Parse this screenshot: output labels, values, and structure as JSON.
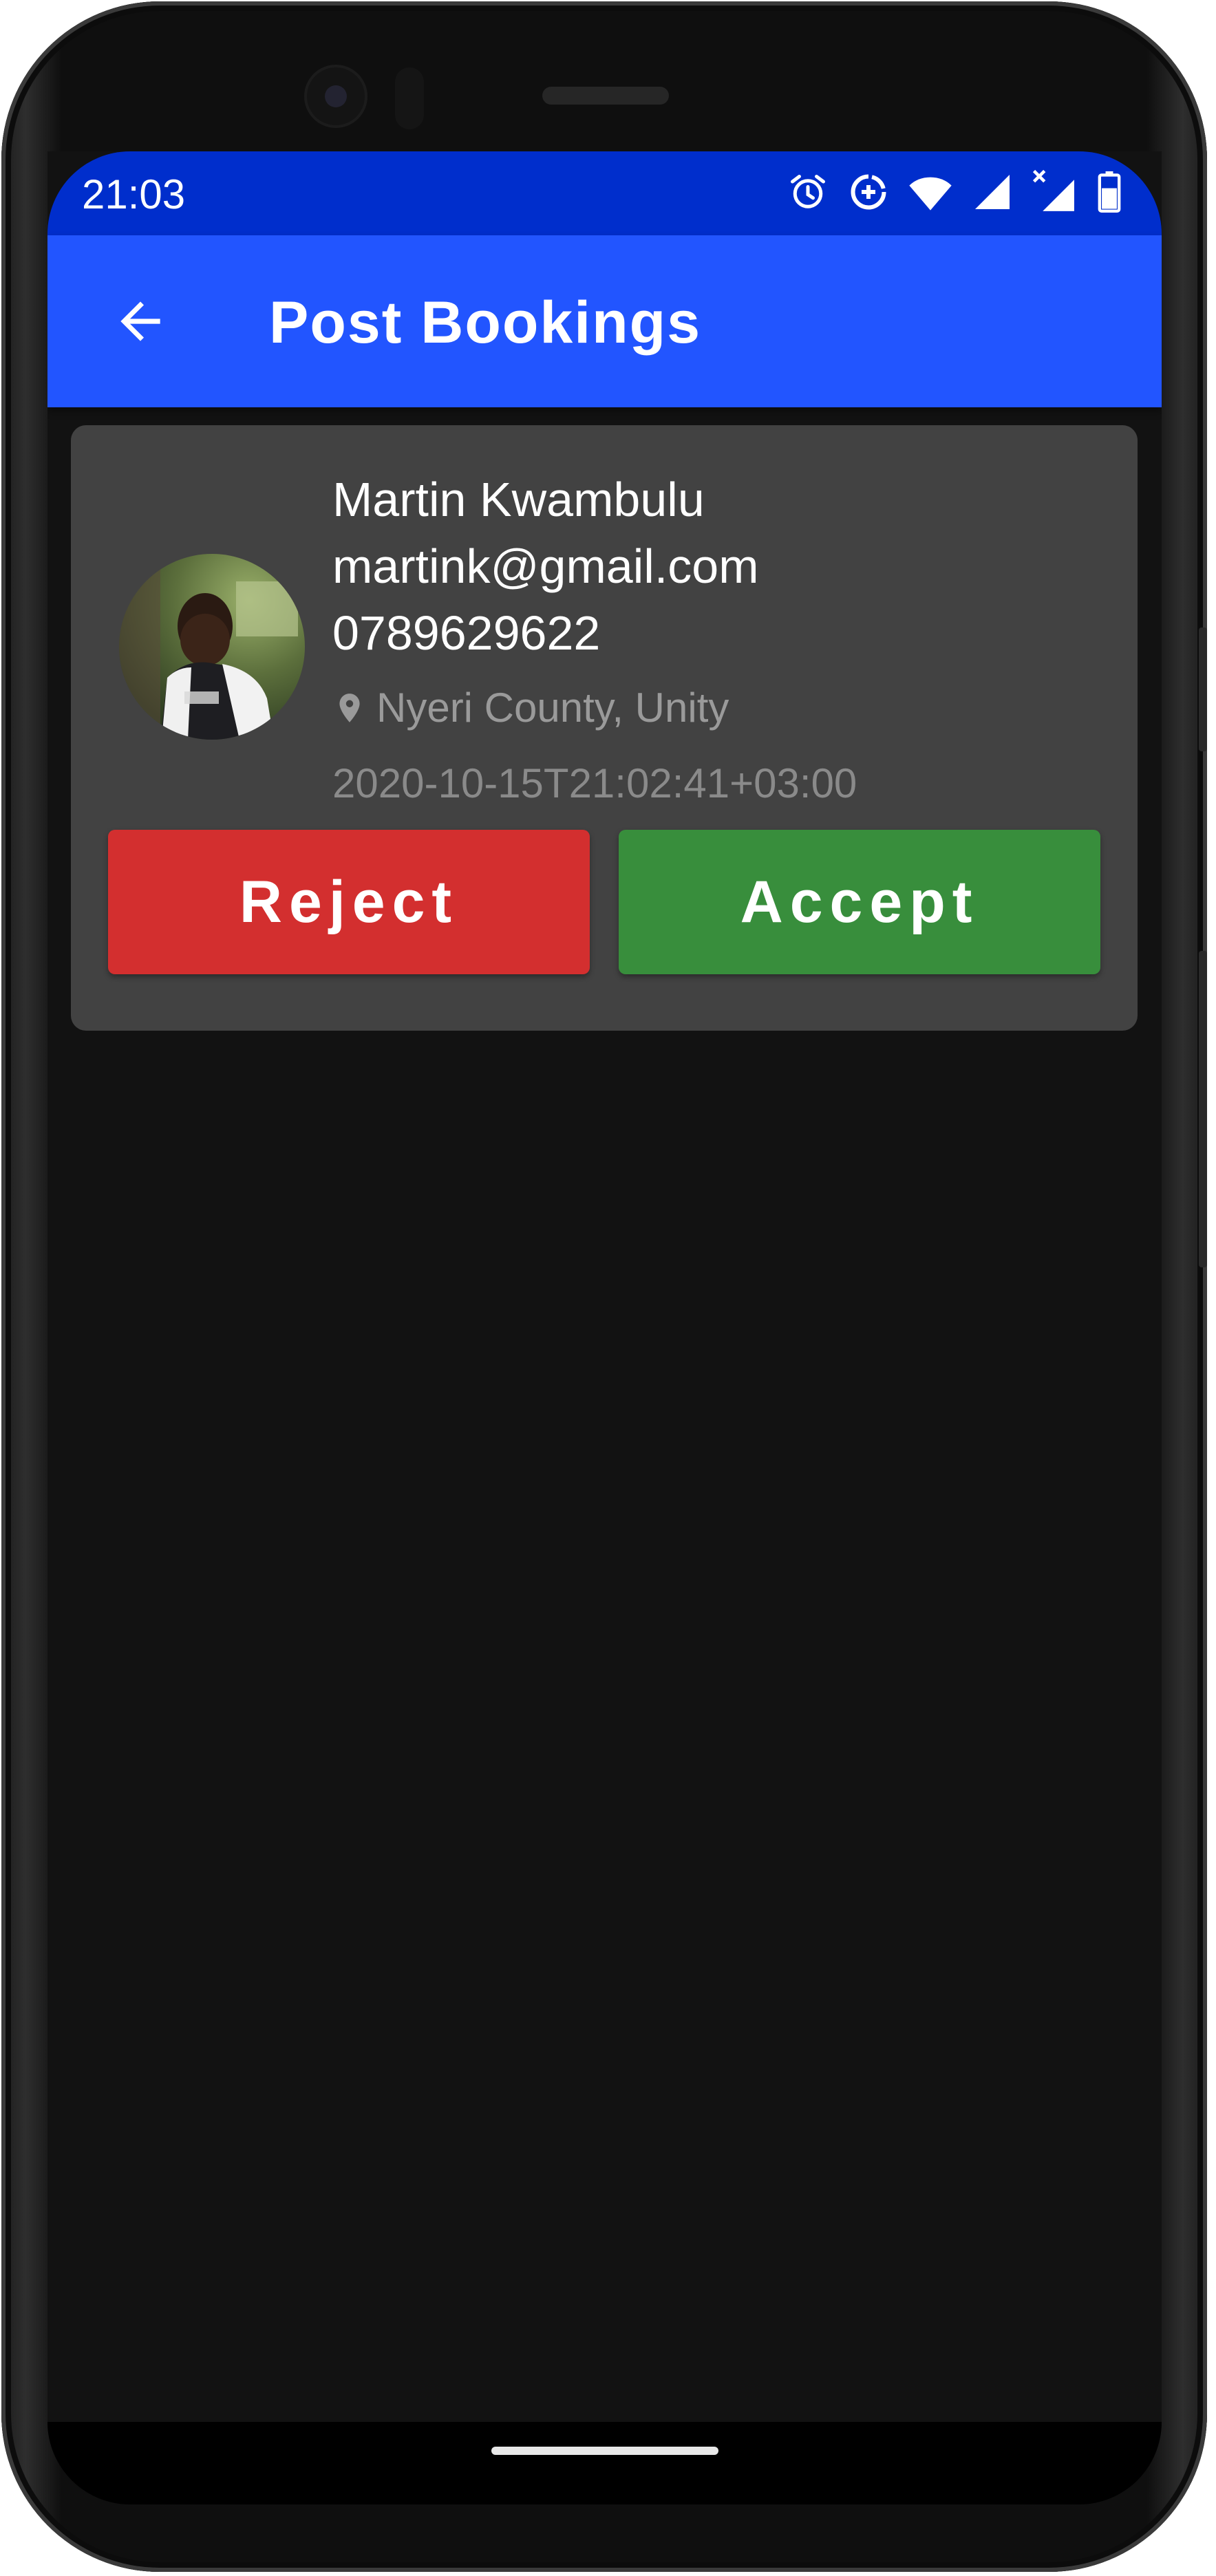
{
  "status_bar": {
    "time": "21:03",
    "icons": [
      "alarm-icon",
      "data-saver-icon",
      "wifi-icon",
      "signal-icon",
      "signal-no-data-icon",
      "battery-icon"
    ]
  },
  "app_bar": {
    "title": "Post Bookings",
    "back_icon": "arrow-back-icon",
    "color": "#2255ff"
  },
  "booking": {
    "name": "Martin Kwambulu",
    "email": "martink@gmail.com",
    "phone": "0789629622",
    "location": "Nyeri County, Unity",
    "timestamp": "2020-10-15T21:02:41+03:00",
    "reject_label": "Reject",
    "accept_label": "Accept",
    "reject_color": "#d32f2f",
    "accept_color": "#388e3c"
  },
  "colors": {
    "status_bar": "#002ecc",
    "background": "#121212",
    "card": "#424242"
  }
}
